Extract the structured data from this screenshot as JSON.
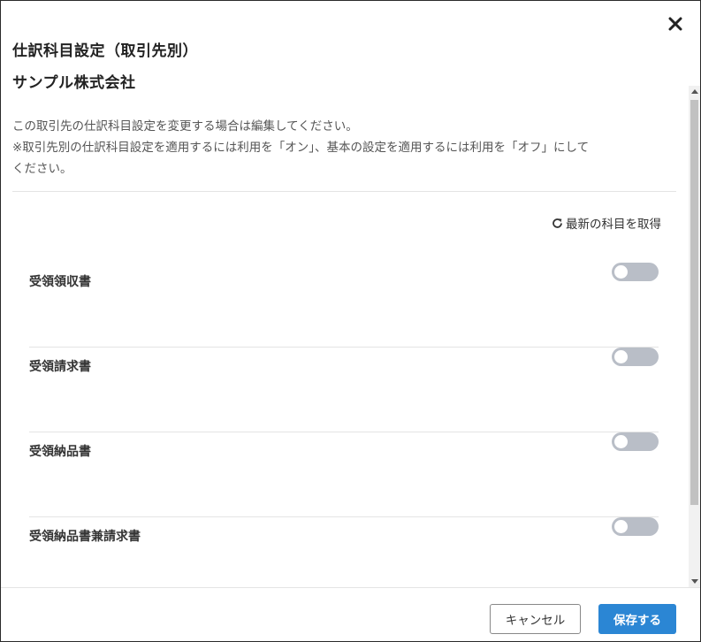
{
  "dialog": {
    "title": "仕訳科目設定（取引先別）",
    "company_name": "サンプル株式会社",
    "close_icon": "close-icon",
    "description_lines": [
      "この取引先の仕訳科目設定を変更する場合は編集してください。",
      "※取引先別の仕訳科目設定を適用するには利用を「オン」、基本の設定を適用するには利用を「オフ」にして",
      "ください。"
    ],
    "refresh": {
      "icon": "refresh-icon",
      "label": "最新の科目を取得"
    }
  },
  "settings": [
    {
      "label": "受領領収書",
      "enabled": false
    },
    {
      "label": "受領請求書",
      "enabled": false
    },
    {
      "label": "受領納品書",
      "enabled": false
    },
    {
      "label": "受領納品書兼請求書",
      "enabled": false
    }
  ],
  "footer": {
    "cancel_label": "キャンセル",
    "save_label": "保存する"
  },
  "colors": {
    "primary": "#2b86d4",
    "toggle_off": "#b9bec7"
  }
}
